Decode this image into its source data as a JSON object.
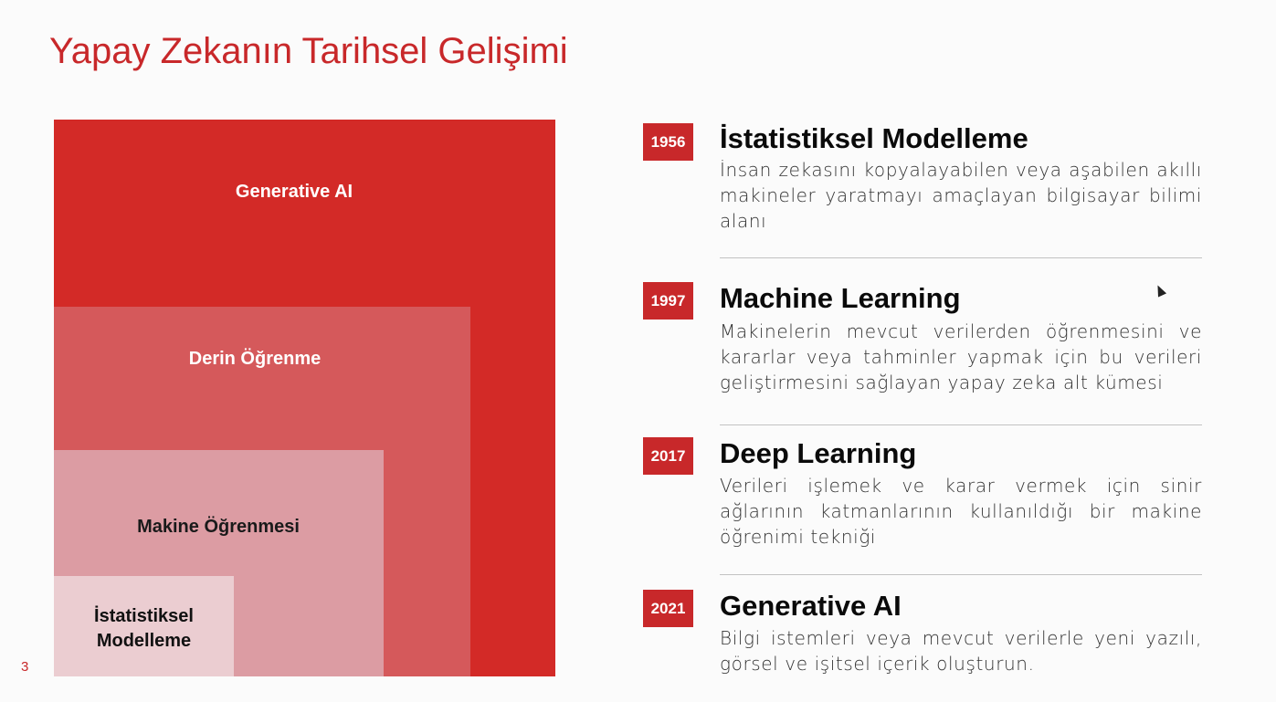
{
  "slide": {
    "title": "Yapay Zekanın Tarihsel Gelişimi",
    "page_number": "3"
  },
  "nested_diagram": {
    "generative_ai": "Generative AI",
    "deep_learning": "Derin Öğrenme",
    "machine_learning": "Makine Öğrenmesi",
    "statistical_line1": "İstatistiksel",
    "statistical_line2": "Modelleme"
  },
  "timeline": [
    {
      "year": "1956",
      "title": "İstatistiksel Modelleme",
      "description": "İnsan zekasını kopyalayabilen veya aşabilen akıllı makineler yaratmayı amaçlayan bilgisayar bilimi alanı"
    },
    {
      "year": "1997",
      "title": "Machine Learning",
      "description": "Makinelerin mevcut verilerden öğrenmesini ve kararlar veya tahminler yapmak için bu verileri geliştirmesini sağlayan yapay zeka alt kümesi"
    },
    {
      "year": "2017",
      "title": "Deep Learning",
      "description": "Verileri işlemek ve karar vermek için sinir ağlarının katmanlarının kullanıldığı bir makine öğrenimi tekniği"
    },
    {
      "year": "2021",
      "title": "Generative AI",
      "description": "Bilgi istemleri veya mevcut verilerle yeni yazılı, görsel ve işitsel içerik oluşturun."
    }
  ],
  "colors": {
    "accent_red": "#c8282a",
    "gen_ai_box": "#d32a27",
    "deep_box": "#d5595b",
    "ml_box": "#dc9ca3",
    "stat_box": "#ebcdd1"
  }
}
